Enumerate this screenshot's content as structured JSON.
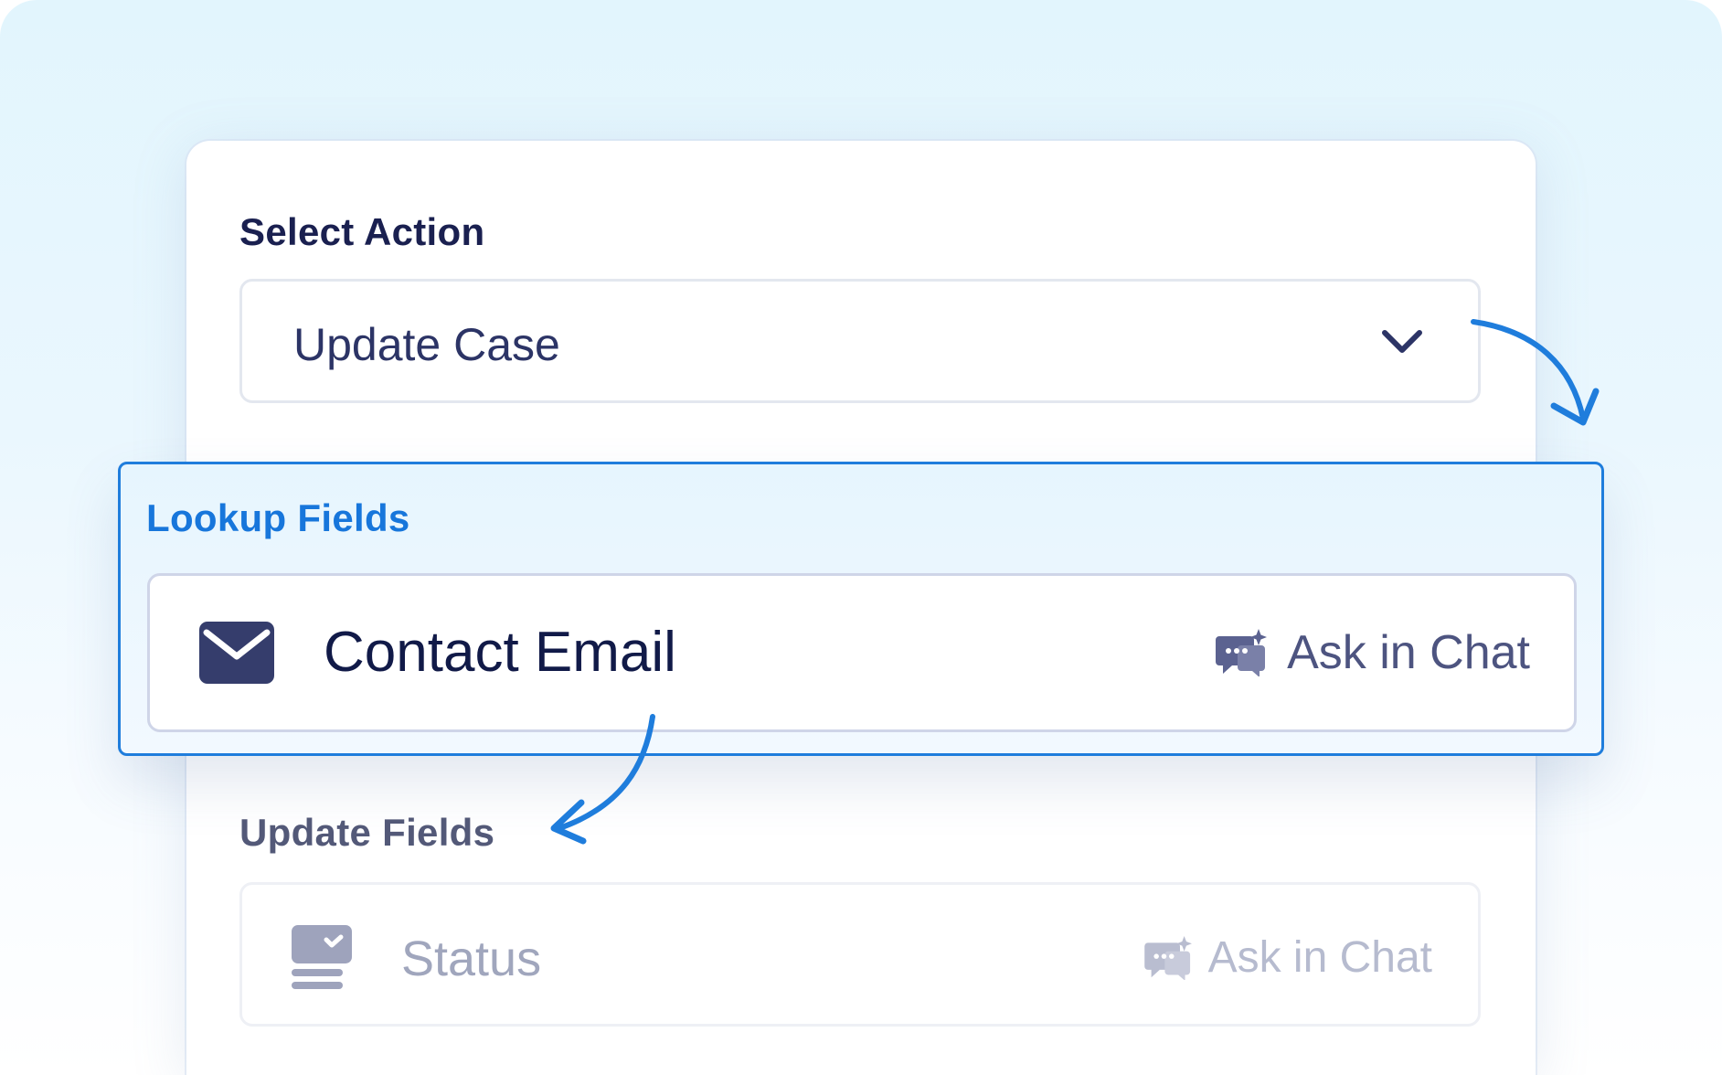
{
  "action": {
    "label": "Select Action",
    "selected_value": "Update Case"
  },
  "lookup": {
    "label": "Lookup Fields",
    "field_name": "Contact Email",
    "ask_label": "Ask in Chat"
  },
  "update": {
    "label": "Update Fields",
    "field_name": "Status",
    "ask_label": "Ask in Chat"
  },
  "colors": {
    "accent": "#1f7ddc",
    "title_dark": "#1a2050",
    "icon_dark": "#353d6c"
  },
  "icons": [
    "chevron-down-icon",
    "mail-icon",
    "chat-sparkle-icon",
    "status-card-icon",
    "curved-arrow-icon"
  ]
}
